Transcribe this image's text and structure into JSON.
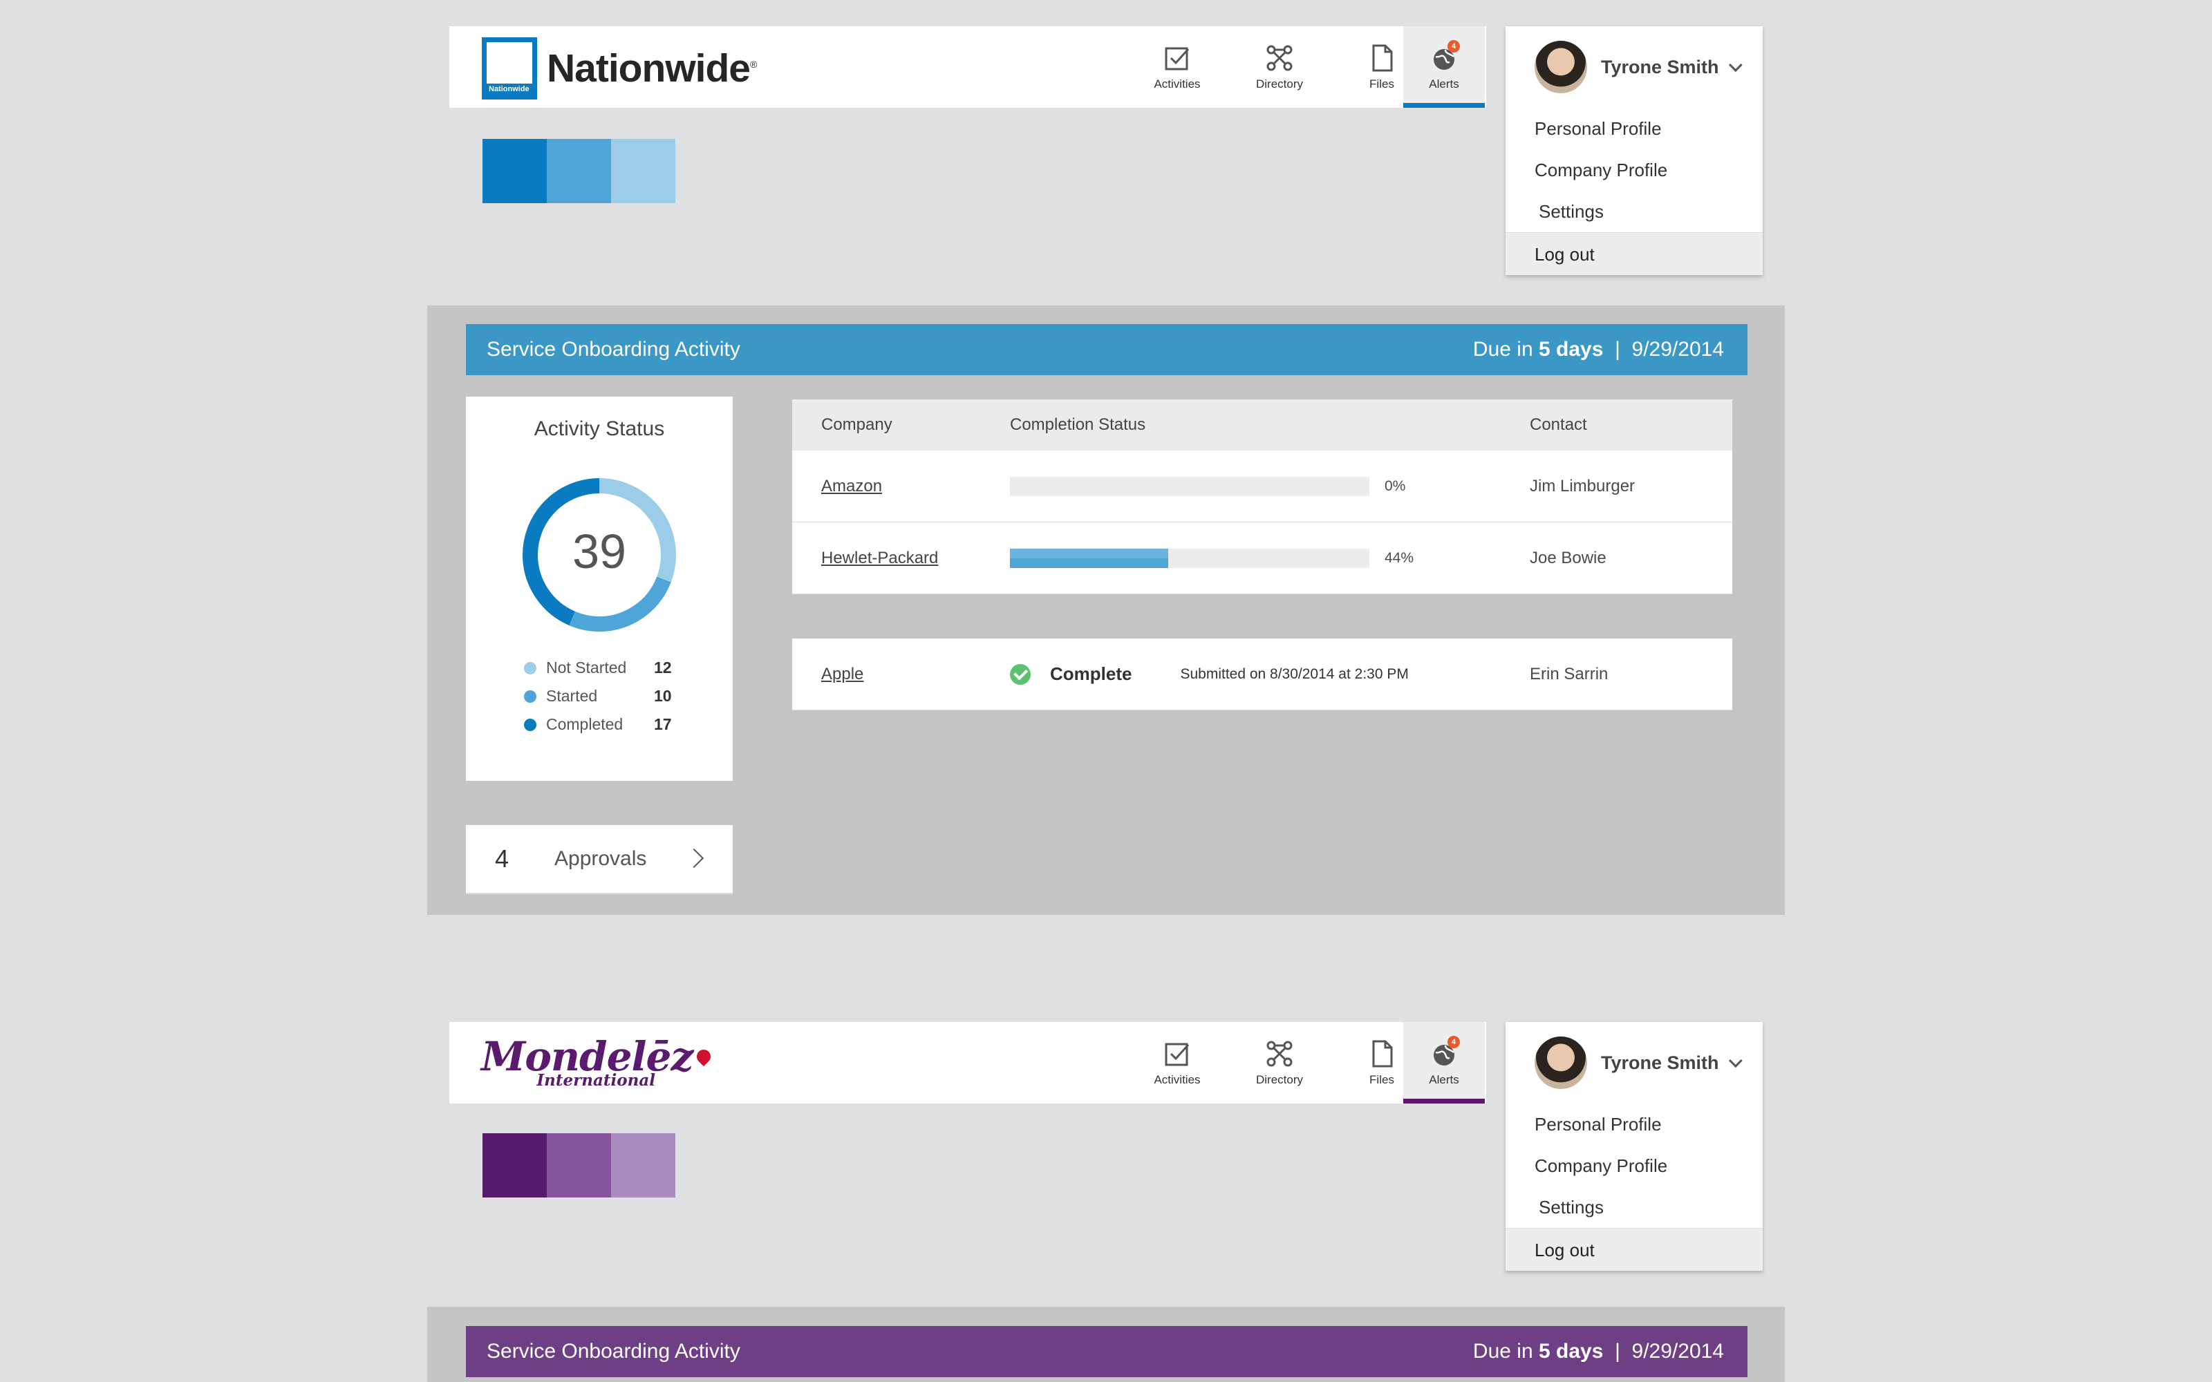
{
  "brands": [
    {
      "id": "nationwide",
      "logo_text": "Nationwide",
      "logo_box_text": "Nationwide",
      "logo_mark": "®",
      "accent": "#0a7bc1",
      "swatches": [
        "#0a7bc1",
        "#4da6d7",
        "#9ccde8"
      ]
    },
    {
      "id": "mondelez",
      "logo_text": "Mondelēz",
      "logo_sub": "International",
      "accent": "#5a1a6e",
      "swatches": [
        "#561a6d",
        "#85549a",
        "#a98bbd"
      ]
    }
  ],
  "nav": {
    "items": [
      {
        "label": "Activities",
        "icon": "checkbox-icon"
      },
      {
        "label": "Directory",
        "icon": "network-icon"
      },
      {
        "label": "Files",
        "icon": "file-icon"
      },
      {
        "label": "Alerts",
        "icon": "globe-icon",
        "badge": "4",
        "active": true
      }
    ]
  },
  "user": {
    "name": "Tyrone Smith",
    "menu": [
      "Personal Profile",
      "Company Profile",
      "Settings"
    ],
    "logout": "Log out"
  },
  "section": {
    "title": "Service Onboarding Activity",
    "due_prefix": "Due in ",
    "due_days": "5 days",
    "due_separator": "|",
    "due_date": "9/29/2014",
    "title_bar_colors": [
      "#3a97c6",
      "#6f3f85"
    ]
  },
  "activity_status": {
    "title": "Activity Status",
    "total": "39",
    "items": [
      {
        "label": "Not Started",
        "count": "12",
        "color": "#9ccde8"
      },
      {
        "label": "Started",
        "count": "10",
        "color": "#4da6d7"
      },
      {
        "label": "Completed",
        "count": "17",
        "color": "#0a7bc1"
      }
    ]
  },
  "approvals": {
    "count": "4",
    "label": "Approvals"
  },
  "table": {
    "headers": [
      "Company",
      "Completion Status",
      "Contact"
    ],
    "rows": [
      {
        "company": "Amazon",
        "progress": 0,
        "pct": "0%",
        "contact": "Jim Limburger"
      },
      {
        "company": "Hewlet-Packard",
        "progress": 0.44,
        "pct": "44%",
        "contact": "Joe Bowie"
      }
    ],
    "completed_row": {
      "company": "Apple",
      "status": "Complete",
      "submitted": "Submitted on 8/30/2014 at 2:30 PM",
      "contact": "Erin Sarrin"
    }
  }
}
